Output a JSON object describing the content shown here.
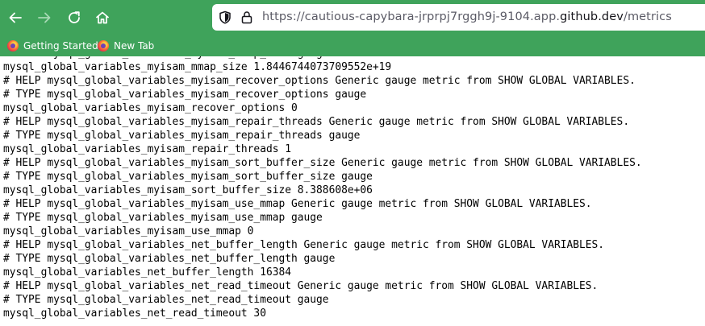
{
  "browser": {
    "url_prefix": "https://cautious-capybara-jrprpj7rggh9j-9104.app.",
    "url_host": "github.dev",
    "url_path": "/metrics",
    "toolbar_color": "#3fa35b",
    "icons": {
      "back": "arrow-left-icon",
      "forward": "arrow-right-icon",
      "reload": "reload-icon",
      "home": "home-icon",
      "shield": "shield-icon",
      "lock": "lock-icon"
    }
  },
  "bookmarks": [
    {
      "label": "Getting Started",
      "icon": "firefox-icon"
    },
    {
      "label": "New Tab",
      "icon": "firefox-icon"
    }
  ],
  "content": {
    "lines": [
      "# TYPE mysql_global_variables_myisam_mmap_size gauge",
      "mysql_global_variables_myisam_mmap_size 1.8446744073709552e+19",
      "# HELP mysql_global_variables_myisam_recover_options Generic gauge metric from SHOW GLOBAL VARIABLES.",
      "# TYPE mysql_global_variables_myisam_recover_options gauge",
      "mysql_global_variables_myisam_recover_options 0",
      "# HELP mysql_global_variables_myisam_repair_threads Generic gauge metric from SHOW GLOBAL VARIABLES.",
      "# TYPE mysql_global_variables_myisam_repair_threads gauge",
      "mysql_global_variables_myisam_repair_threads 1",
      "# HELP mysql_global_variables_myisam_sort_buffer_size Generic gauge metric from SHOW GLOBAL VARIABLES.",
      "# TYPE mysql_global_variables_myisam_sort_buffer_size gauge",
      "mysql_global_variables_myisam_sort_buffer_size 8.388608e+06",
      "# HELP mysql_global_variables_myisam_use_mmap Generic gauge metric from SHOW GLOBAL VARIABLES.",
      "# TYPE mysql_global_variables_myisam_use_mmap gauge",
      "mysql_global_variables_myisam_use_mmap 0",
      "# HELP mysql_global_variables_net_buffer_length Generic gauge metric from SHOW GLOBAL VARIABLES.",
      "# TYPE mysql_global_variables_net_buffer_length gauge",
      "mysql_global_variables_net_buffer_length 16384",
      "# HELP mysql_global_variables_net_read_timeout Generic gauge metric from SHOW GLOBAL VARIABLES.",
      "# TYPE mysql_global_variables_net_read_timeout gauge",
      "mysql_global_variables_net_read_timeout 30"
    ]
  }
}
